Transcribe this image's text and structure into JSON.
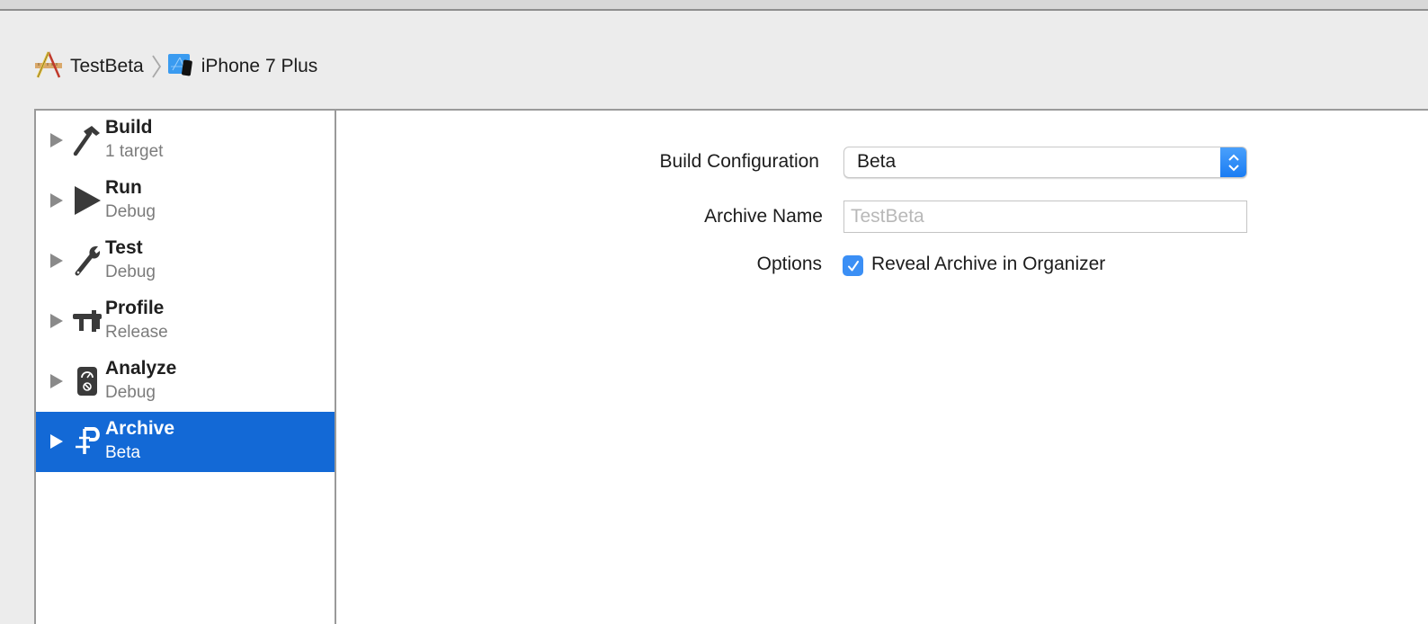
{
  "breadcrumb": {
    "project": {
      "label": "TestBeta",
      "icon": "xcode-project-icon"
    },
    "separator_icon": "chevron-right-icon",
    "destination": {
      "label": "iPhone 7 Plus",
      "icon": "iphone-simulator-icon"
    }
  },
  "sidebar": {
    "items": [
      {
        "title": "Build",
        "subtitle": "1 target",
        "icon": "hammer-icon",
        "selected": false
      },
      {
        "title": "Run",
        "subtitle": "Debug",
        "icon": "play-icon",
        "selected": false
      },
      {
        "title": "Test",
        "subtitle": "Debug",
        "icon": "wrench-icon",
        "selected": false
      },
      {
        "title": "Profile",
        "subtitle": "Release",
        "icon": "caliper-icon",
        "selected": false
      },
      {
        "title": "Analyze",
        "subtitle": "Debug",
        "icon": "analyze-icon",
        "selected": false
      },
      {
        "title": "Archive",
        "subtitle": "Beta",
        "icon": "archive-clamp-icon",
        "selected": true
      }
    ]
  },
  "form": {
    "build_configuration": {
      "label": "Build Configuration",
      "value": "Beta"
    },
    "archive_name": {
      "label": "Archive Name",
      "value": "",
      "placeholder": "TestBeta"
    },
    "options": {
      "label": "Options",
      "checkbox_label": "Reveal Archive in Organizer",
      "checked": true
    }
  },
  "colors": {
    "selection": "#1369d6",
    "accent": "#1a7cf3",
    "checkbox": "#3b8ff5"
  }
}
